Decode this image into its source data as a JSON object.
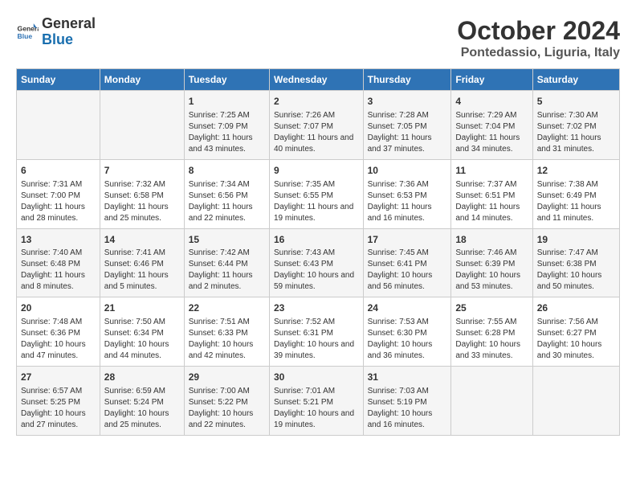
{
  "header": {
    "logo_text_general": "General",
    "logo_text_blue": "Blue",
    "month_title": "October 2024",
    "location": "Pontedassio, Liguria, Italy"
  },
  "weekdays": [
    "Sunday",
    "Monday",
    "Tuesday",
    "Wednesday",
    "Thursday",
    "Friday",
    "Saturday"
  ],
  "weeks": [
    [
      {
        "day": "",
        "info": ""
      },
      {
        "day": "",
        "info": ""
      },
      {
        "day": "1",
        "info": "Sunrise: 7:25 AM\nSunset: 7:09 PM\nDaylight: 11 hours and 43 minutes."
      },
      {
        "day": "2",
        "info": "Sunrise: 7:26 AM\nSunset: 7:07 PM\nDaylight: 11 hours and 40 minutes."
      },
      {
        "day": "3",
        "info": "Sunrise: 7:28 AM\nSunset: 7:05 PM\nDaylight: 11 hours and 37 minutes."
      },
      {
        "day": "4",
        "info": "Sunrise: 7:29 AM\nSunset: 7:04 PM\nDaylight: 11 hours and 34 minutes."
      },
      {
        "day": "5",
        "info": "Sunrise: 7:30 AM\nSunset: 7:02 PM\nDaylight: 11 hours and 31 minutes."
      }
    ],
    [
      {
        "day": "6",
        "info": "Sunrise: 7:31 AM\nSunset: 7:00 PM\nDaylight: 11 hours and 28 minutes."
      },
      {
        "day": "7",
        "info": "Sunrise: 7:32 AM\nSunset: 6:58 PM\nDaylight: 11 hours and 25 minutes."
      },
      {
        "day": "8",
        "info": "Sunrise: 7:34 AM\nSunset: 6:56 PM\nDaylight: 11 hours and 22 minutes."
      },
      {
        "day": "9",
        "info": "Sunrise: 7:35 AM\nSunset: 6:55 PM\nDaylight: 11 hours and 19 minutes."
      },
      {
        "day": "10",
        "info": "Sunrise: 7:36 AM\nSunset: 6:53 PM\nDaylight: 11 hours and 16 minutes."
      },
      {
        "day": "11",
        "info": "Sunrise: 7:37 AM\nSunset: 6:51 PM\nDaylight: 11 hours and 14 minutes."
      },
      {
        "day": "12",
        "info": "Sunrise: 7:38 AM\nSunset: 6:49 PM\nDaylight: 11 hours and 11 minutes."
      }
    ],
    [
      {
        "day": "13",
        "info": "Sunrise: 7:40 AM\nSunset: 6:48 PM\nDaylight: 11 hours and 8 minutes."
      },
      {
        "day": "14",
        "info": "Sunrise: 7:41 AM\nSunset: 6:46 PM\nDaylight: 11 hours and 5 minutes."
      },
      {
        "day": "15",
        "info": "Sunrise: 7:42 AM\nSunset: 6:44 PM\nDaylight: 11 hours and 2 minutes."
      },
      {
        "day": "16",
        "info": "Sunrise: 7:43 AM\nSunset: 6:43 PM\nDaylight: 10 hours and 59 minutes."
      },
      {
        "day": "17",
        "info": "Sunrise: 7:45 AM\nSunset: 6:41 PM\nDaylight: 10 hours and 56 minutes."
      },
      {
        "day": "18",
        "info": "Sunrise: 7:46 AM\nSunset: 6:39 PM\nDaylight: 10 hours and 53 minutes."
      },
      {
        "day": "19",
        "info": "Sunrise: 7:47 AM\nSunset: 6:38 PM\nDaylight: 10 hours and 50 minutes."
      }
    ],
    [
      {
        "day": "20",
        "info": "Sunrise: 7:48 AM\nSunset: 6:36 PM\nDaylight: 10 hours and 47 minutes."
      },
      {
        "day": "21",
        "info": "Sunrise: 7:50 AM\nSunset: 6:34 PM\nDaylight: 10 hours and 44 minutes."
      },
      {
        "day": "22",
        "info": "Sunrise: 7:51 AM\nSunset: 6:33 PM\nDaylight: 10 hours and 42 minutes."
      },
      {
        "day": "23",
        "info": "Sunrise: 7:52 AM\nSunset: 6:31 PM\nDaylight: 10 hours and 39 minutes."
      },
      {
        "day": "24",
        "info": "Sunrise: 7:53 AM\nSunset: 6:30 PM\nDaylight: 10 hours and 36 minutes."
      },
      {
        "day": "25",
        "info": "Sunrise: 7:55 AM\nSunset: 6:28 PM\nDaylight: 10 hours and 33 minutes."
      },
      {
        "day": "26",
        "info": "Sunrise: 7:56 AM\nSunset: 6:27 PM\nDaylight: 10 hours and 30 minutes."
      }
    ],
    [
      {
        "day": "27",
        "info": "Sunrise: 6:57 AM\nSunset: 5:25 PM\nDaylight: 10 hours and 27 minutes."
      },
      {
        "day": "28",
        "info": "Sunrise: 6:59 AM\nSunset: 5:24 PM\nDaylight: 10 hours and 25 minutes."
      },
      {
        "day": "29",
        "info": "Sunrise: 7:00 AM\nSunset: 5:22 PM\nDaylight: 10 hours and 22 minutes."
      },
      {
        "day": "30",
        "info": "Sunrise: 7:01 AM\nSunset: 5:21 PM\nDaylight: 10 hours and 19 minutes."
      },
      {
        "day": "31",
        "info": "Sunrise: 7:03 AM\nSunset: 5:19 PM\nDaylight: 10 hours and 16 minutes."
      },
      {
        "day": "",
        "info": ""
      },
      {
        "day": "",
        "info": ""
      }
    ]
  ]
}
